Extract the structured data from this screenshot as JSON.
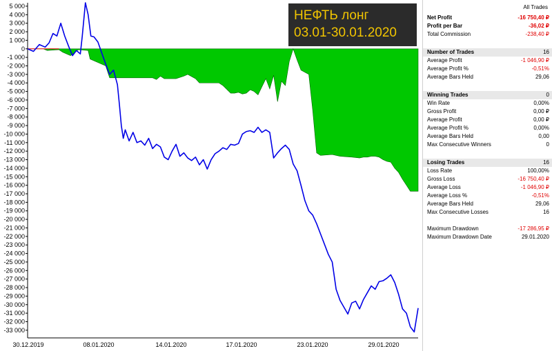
{
  "title": {
    "line1": "НЕФТЬ лонг",
    "line2": "03.01-30.01.2020"
  },
  "colors": {
    "equity_line": "#0000e6",
    "drawdown_fill": "#00c800",
    "title_bg": "#2b2b2b",
    "title_text": "#f2c500",
    "negative_value": "#e00000"
  },
  "chart_data": {
    "type": "line",
    "y_ticks": [
      "5 000",
      "4 000",
      "3 000",
      "2 000",
      "1 000",
      "0",
      "-1 000",
      "-2 000",
      "-3 000",
      "-4 000",
      "-5 000",
      "-6 000",
      "-7 000",
      "-8 000",
      "-9 000",
      "-10 000",
      "-11 000",
      "-12 000",
      "-13 000",
      "-14 000",
      "-15 000",
      "-16 000",
      "-17 000",
      "-18 000",
      "-19 000",
      "-20 000",
      "-21 000",
      "-22 000",
      "-23 000",
      "-24 000",
      "-25 000",
      "-26 000",
      "-27 000",
      "-28 000",
      "-29 000",
      "-30 000",
      "-31 000",
      "-32 000",
      "-33 000"
    ],
    "x_ticks": [
      "30.12.2019",
      "08.01.2020",
      "14.01.2020",
      "17.01.2020",
      "23.01.2020",
      "29.01.2020"
    ],
    "ylim": [
      -33900,
      5400
    ],
    "xlim": [
      0,
      100
    ],
    "grid": false,
    "series": [
      {
        "kind": "line",
        "x": [
          0,
          1.5,
          3,
          4.5,
          5.5,
          6.5,
          7.5,
          8.5,
          9.5,
          10.5,
          11.5,
          12.5,
          13.5,
          14,
          14.8,
          15.5,
          16.2,
          17,
          18,
          19,
          20,
          21,
          22,
          23,
          23.5,
          24,
          24.5,
          25,
          26,
          27,
          28,
          29,
          30,
          31,
          32,
          33,
          34,
          35,
          36,
          37,
          38,
          39,
          40,
          41,
          42,
          43,
          44,
          45,
          46,
          47,
          48,
          49,
          50,
          51,
          52,
          53,
          54,
          55,
          56,
          57,
          58,
          59,
          60,
          61,
          62,
          63,
          64,
          65,
          66,
          67,
          68,
          69,
          70,
          71,
          72,
          73,
          74,
          75,
          76,
          77,
          78,
          79,
          80,
          81,
          82,
          83,
          84,
          85,
          86,
          87,
          88,
          89,
          90,
          91,
          92,
          93,
          94,
          95,
          96,
          97,
          98,
          99,
          100
        ],
        "y": [
          0,
          -300,
          500,
          200,
          700,
          1800,
          1500,
          3000,
          1500,
          300,
          -800,
          -200,
          -600,
          1500,
          5400,
          4000,
          1500,
          1400,
          800,
          -500,
          -1800,
          -3000,
          -2500,
          -4200,
          -6500,
          -9000,
          -10500,
          -9500,
          -10800,
          -9800,
          -11000,
          -10800,
          -11300,
          -10500,
          -11700,
          -11200,
          -11500,
          -12700,
          -13000,
          -12000,
          -11200,
          -12600,
          -12200,
          -12800,
          -13100,
          -12700,
          -13600,
          -13000,
          -14100,
          -13000,
          -12300,
          -12000,
          -11600,
          -11800,
          -11200,
          -11300,
          -11100,
          -10000,
          -9700,
          -9600,
          -9800,
          -9200,
          -9800,
          -9500,
          -9800,
          -12800,
          -12200,
          -11700,
          -11300,
          -11800,
          -13500,
          -14300,
          -16000,
          -17800,
          -19000,
          -19500,
          -20500,
          -21700,
          -22900,
          -24100,
          -25000,
          -28200,
          -29500,
          -30300,
          -31100,
          -29800,
          -29600,
          -30500,
          -29400,
          -28600,
          -27800,
          -28200,
          -27300,
          -27200,
          -26900,
          -26500,
          -27400,
          -28800,
          -30500,
          -31000,
          -32600,
          -33200,
          -30400
        ]
      },
      {
        "kind": "drawdown_area",
        "x": [
          0,
          4,
          5,
          8,
          9,
          11,
          13,
          15.5,
          16,
          20,
          21,
          32,
          33,
          34,
          35,
          38,
          40,
          41,
          43,
          44,
          49,
          50,
          52,
          53,
          54,
          55,
          56,
          57,
          58,
          59,
          61,
          62,
          63,
          64,
          65,
          66,
          67,
          68,
          69,
          70,
          72,
          73,
          74,
          75,
          78,
          80,
          83,
          85,
          86,
          87,
          88,
          89,
          90,
          91,
          92,
          93,
          94,
          95,
          96,
          97,
          98,
          99,
          100
        ],
        "y": [
          0,
          0,
          -200,
          -100,
          -400,
          -800,
          -100,
          -200,
          -1200,
          -2000,
          -3400,
          -3400,
          -3600,
          -3200,
          -3500,
          -3500,
          -3200,
          -3000,
          -3500,
          -4000,
          -4000,
          -4300,
          -5200,
          -5200,
          -5100,
          -5300,
          -5200,
          -4800,
          -5000,
          -5400,
          -3500,
          -4700,
          -3100,
          -6200,
          -3800,
          -4300,
          -1500,
          0,
          -1300,
          -2500,
          -3000,
          -7200,
          -12200,
          -12500,
          -12400,
          -12600,
          -12700,
          -12800,
          -12700,
          -12700,
          -12600,
          -12600,
          -12700,
          -13000,
          -13200,
          -13300,
          -14000,
          -14500,
          -15300,
          -16000,
          -16700,
          -16700,
          -16700
        ]
      }
    ]
  },
  "stats": {
    "header": "All Trades",
    "summary": [
      {
        "label": "Net Profit",
        "value": "-16 750,40 ₽",
        "bold": true,
        "red": true
      },
      {
        "label": "Profit per Bar",
        "value": "-36,02 ₽",
        "bold": true,
        "red": true
      },
      {
        "label": "Total Commission",
        "value": "-238,40 ₽",
        "bold": false,
        "red": true
      }
    ],
    "trades_header": {
      "label": "Number of Trades",
      "value": "16"
    },
    "trades": [
      {
        "label": "Average Profit",
        "value": "-1 046,90 ₽",
        "red": true
      },
      {
        "label": "Average Profit %",
        "value": "-0,51%",
        "red": true
      },
      {
        "label": "Average Bars Held",
        "value": "29,06",
        "red": false
      }
    ],
    "winning_header": {
      "label": "Winning Trades",
      "value": "0"
    },
    "winning": [
      {
        "label": "Win Rate",
        "value": "0,00%",
        "red": false
      },
      {
        "label": "Gross Profit",
        "value": "0,00 ₽",
        "red": false
      },
      {
        "label": "Average Profit",
        "value": "0,00 ₽",
        "red": false
      },
      {
        "label": "Average Profit %",
        "value": "0,00%",
        "red": false
      },
      {
        "label": "Average Bars Held",
        "value": "0,00",
        "red": false
      },
      {
        "label": "Max Consecutive Winners",
        "value": "0",
        "red": false
      }
    ],
    "losing_header": {
      "label": "Losing Trades",
      "value": "16"
    },
    "losing": [
      {
        "label": "Loss Rate",
        "value": "100,00%",
        "red": false
      },
      {
        "label": "Gross Loss",
        "value": "-16 750,40 ₽",
        "red": true
      },
      {
        "label": "Average Loss",
        "value": "-1 046,90 ₽",
        "red": true
      },
      {
        "label": "Average Loss %",
        "value": "-0,51%",
        "red": true
      },
      {
        "label": "Average Bars Held",
        "value": "29,06",
        "red": false
      },
      {
        "label": "Max Consecutive Losses",
        "value": "16",
        "red": false
      }
    ],
    "drawdown": [
      {
        "label": "Maximum Drawdown",
        "value": "-17 286,95 ₽",
        "red": true
      },
      {
        "label": "Maximum Drawdown Date",
        "value": "29.01.2020",
        "red": false
      }
    ]
  }
}
